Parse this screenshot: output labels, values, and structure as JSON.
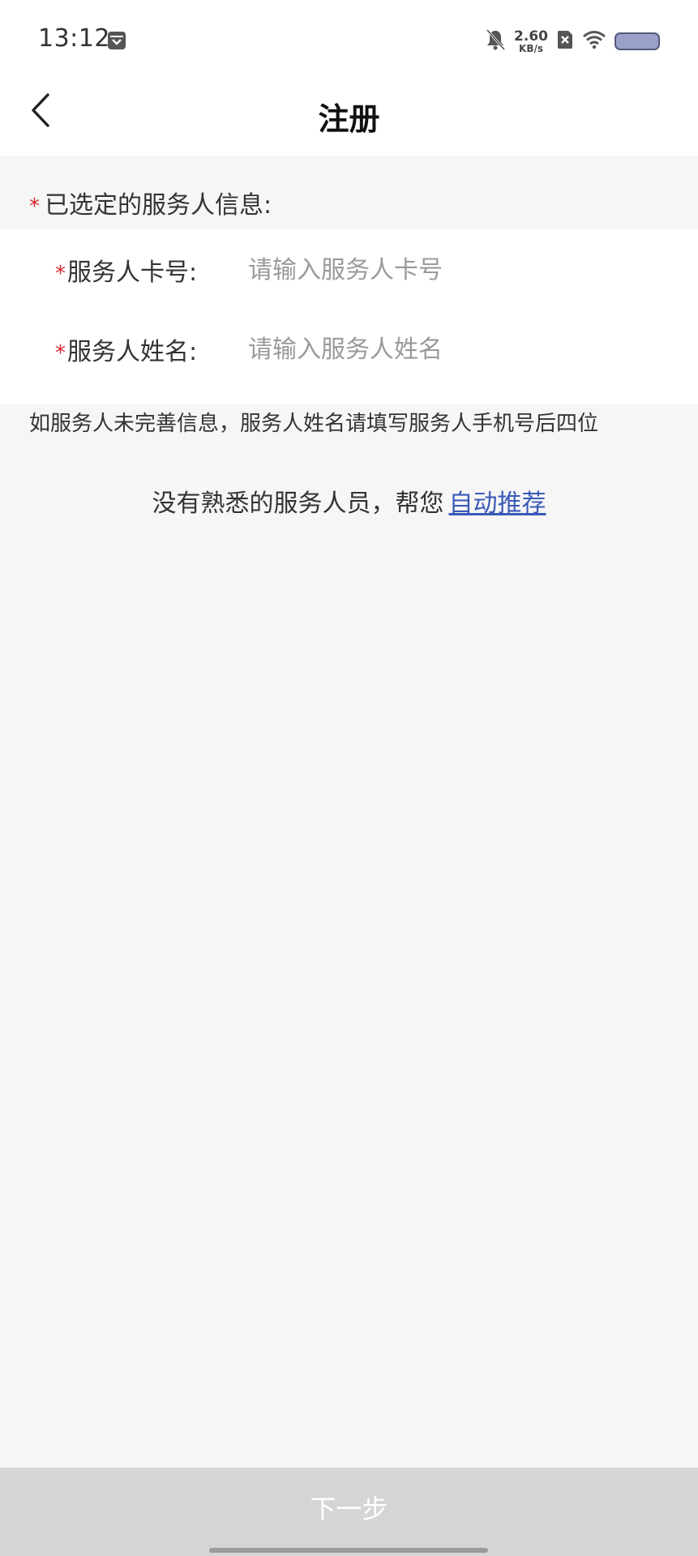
{
  "status_bar": {
    "time": "13:12",
    "net_speed_value": "2.60",
    "net_speed_unit": "KB/s",
    "icons": [
      "box-icon",
      "bell-off-icon",
      "sim-off-icon",
      "wifi-icon",
      "battery-icon"
    ]
  },
  "nav": {
    "title": "注册",
    "back_icon": "chevron-left-icon"
  },
  "section": {
    "required_mark": "*",
    "title": "已选定的服务人信息:"
  },
  "form": {
    "card_number": {
      "required_mark": "*",
      "label": "服务人卡号:",
      "value": "",
      "placeholder": "请输入服务人卡号"
    },
    "name": {
      "required_mark": "*",
      "label": "服务人姓名:",
      "value": "",
      "placeholder": "请输入服务人姓名"
    }
  },
  "hint": "如服务人未完善信息，服务人姓名请填写服务人手机号后四位",
  "recommend": {
    "text": "没有熟悉的服务人员，帮您",
    "link": "自动推荐"
  },
  "footer": {
    "next_label": "下一步"
  },
  "colors": {
    "required": "#d8262e",
    "link": "#3a5ab8",
    "disabled_button": "#d5d5d5",
    "page_bg": "#f6f6f6"
  }
}
